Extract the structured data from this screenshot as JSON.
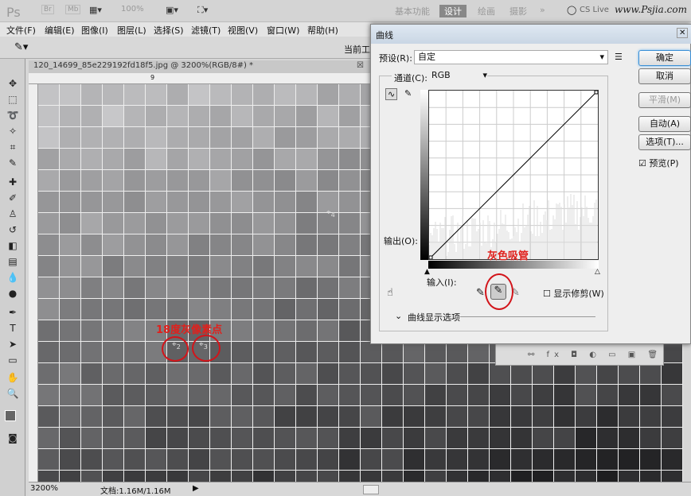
{
  "appbar": {
    "logo": "Ps",
    "br": "Br",
    "mb": "Mb",
    "zoom": "100%",
    "workspaces": [
      "基本功能",
      "设计",
      "绘画",
      "摄影"
    ],
    "more": "»",
    "cs_live": "CS Live",
    "watermark": "www.Psjia.com"
  },
  "menu": [
    "文件(F)",
    "编辑(E)",
    "图像(I)",
    "图层(L)",
    "选择(S)",
    "滤镜(T)",
    "视图(V)",
    "窗口(W)",
    "帮助(H)"
  ],
  "options": {
    "workspace_label": "当前工"
  },
  "document": {
    "tab": "120_14699_85e229192fd18f5.jpg @ 3200%(RGB/8#) *",
    "ruler_mark": "9"
  },
  "status": {
    "zoom": "3200%",
    "doc": "文档:1.16M/1.16M"
  },
  "annotations": {
    "sample_points": "18度灰像素点",
    "point2": "2",
    "point3": "3",
    "point4": "4",
    "gray_picker": "灰色吸管"
  },
  "dialog": {
    "title": "曲线",
    "preset_label": "预设(R):",
    "preset_value": "自定",
    "channel_label": "通道(C):",
    "channel_value": "RGB",
    "output_label": "输出(O):",
    "input_label": "输入(I):",
    "show_clipping": "显示修剪(W)",
    "show_clipping_checked": false,
    "display_options": "曲线显示选项",
    "buttons": {
      "ok": "确定",
      "cancel": "取消",
      "smooth": "平滑(M)",
      "auto": "自动(A)",
      "options": "选项(T)...",
      "preview": "预览(P)"
    },
    "preview_checked": true
  },
  "colors": {
    "accent": "#d2141a"
  }
}
